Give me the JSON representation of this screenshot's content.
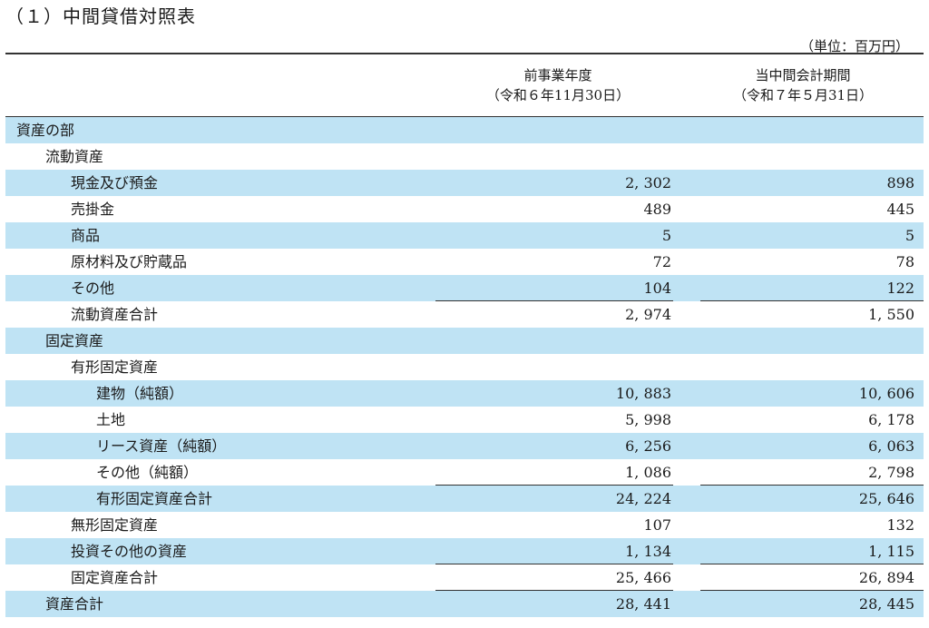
{
  "title": "（１）中間貸借対照表",
  "unit": "（単位：百万円）",
  "columns": {
    "prev": {
      "line1": "前事業年度",
      "line2": "（令和６年11月30日）"
    },
    "curr": {
      "line1": "当中間会計期間",
      "line2": "（令和７年５月31日）"
    }
  },
  "rows": [
    {
      "label": "資産の部",
      "level": 0,
      "v1": "",
      "v2": "",
      "shade": true,
      "underline": false
    },
    {
      "label": "流動資産",
      "level": 1,
      "v1": "",
      "v2": "",
      "shade": false,
      "underline": false
    },
    {
      "label": "現金及び預金",
      "level": 2,
      "v1": "2, 302",
      "v2": "898",
      "shade": true,
      "underline": false
    },
    {
      "label": "売掛金",
      "level": 2,
      "v1": "489",
      "v2": "445",
      "shade": false,
      "underline": false
    },
    {
      "label": "商品",
      "level": 2,
      "v1": "5",
      "v2": "5",
      "shade": true,
      "underline": false
    },
    {
      "label": "原材料及び貯蔵品",
      "level": 2,
      "v1": "72",
      "v2": "78",
      "shade": false,
      "underline": false
    },
    {
      "label": "その他",
      "level": 2,
      "v1": "104",
      "v2": "122",
      "shade": true,
      "underline": true
    },
    {
      "label": "流動資産合計",
      "level": 2,
      "v1": "2, 974",
      "v2": "1, 550",
      "shade": false,
      "underline": false
    },
    {
      "label": "固定資産",
      "level": 1,
      "v1": "",
      "v2": "",
      "shade": true,
      "underline": false
    },
    {
      "label": "有形固定資産",
      "level": 2,
      "v1": "",
      "v2": "",
      "shade": false,
      "underline": false
    },
    {
      "label": "建物（純額）",
      "level": 3,
      "v1": "10, 883",
      "v2": "10, 606",
      "shade": true,
      "underline": false
    },
    {
      "label": "土地",
      "level": 3,
      "v1": "5, 998",
      "v2": "6, 178",
      "shade": false,
      "underline": false
    },
    {
      "label": "リース資産（純額）",
      "level": 3,
      "v1": "6, 256",
      "v2": "6, 063",
      "shade": true,
      "underline": false
    },
    {
      "label": "その他（純額）",
      "level": 3,
      "v1": "1, 086",
      "v2": "2, 798",
      "shade": false,
      "underline": true
    },
    {
      "label": "有形固定資産合計",
      "level": 3,
      "v1": "24, 224",
      "v2": "25, 646",
      "shade": true,
      "underline": false
    },
    {
      "label": "無形固定資産",
      "level": 2,
      "v1": "107",
      "v2": "132",
      "shade": false,
      "underline": false
    },
    {
      "label": "投資その他の資産",
      "level": 2,
      "v1": "1, 134",
      "v2": "1, 115",
      "shade": true,
      "underline": true
    },
    {
      "label": "固定資産合計",
      "level": 2,
      "v1": "25, 466",
      "v2": "26, 894",
      "shade": false,
      "underline": true
    },
    {
      "label": "資産合計",
      "level": 1,
      "v1": "28, 441",
      "v2": "28, 445",
      "shade": true,
      "underline": false
    }
  ]
}
